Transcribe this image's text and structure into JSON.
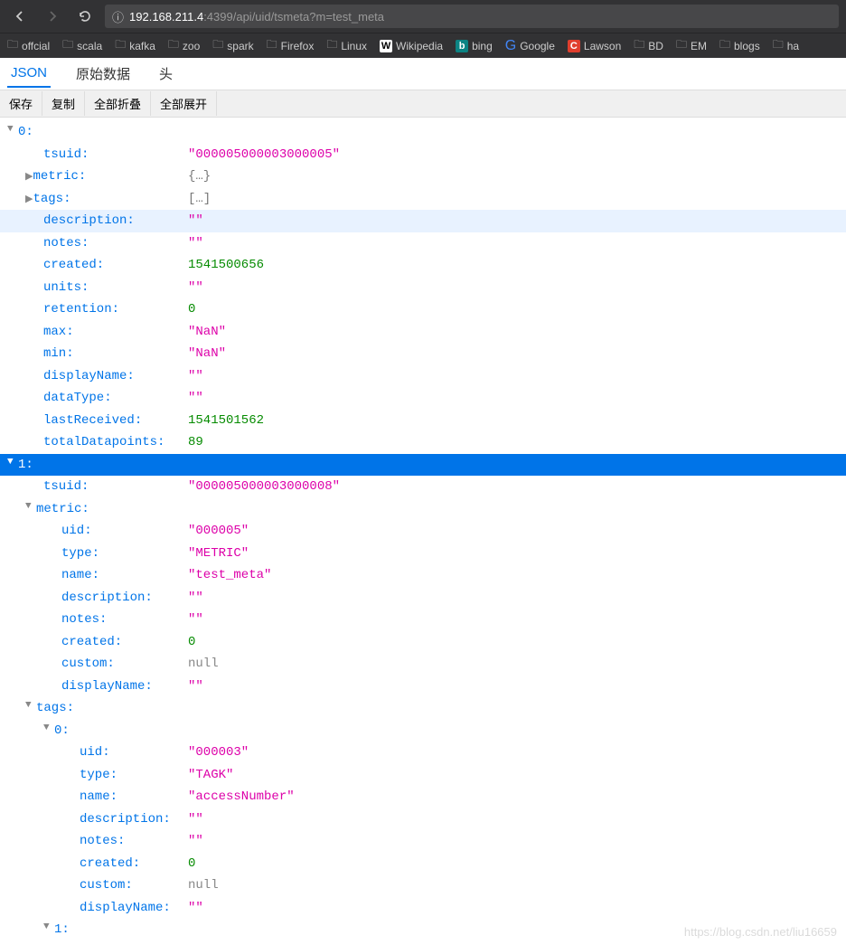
{
  "nav": {
    "url_host": "192.168.211.4",
    "url_port": ":4399",
    "url_path": "/api/uid/tsmeta?m=test_meta"
  },
  "bookmarks": [
    "offcial",
    "scala",
    "kafka",
    "zoo",
    "spark",
    "Firefox",
    "Linux",
    "Wikipedia",
    "bing",
    "Google",
    "Lawson",
    "BD",
    "EM",
    "blogs",
    "ha"
  ],
  "tabs": {
    "json": "JSON",
    "raw": "原始数据",
    "headers": "头"
  },
  "toolbar": {
    "save": "保存",
    "copy": "复制",
    "collapse": "全部折叠",
    "expand": "全部展开"
  },
  "json": {
    "idx0": "0:",
    "idx1": "1:",
    "item0": {
      "tsuid_k": "tsuid:",
      "tsuid_v": "\"000005000003000005\"",
      "metric_k": "metric:",
      "metric_v": "{…}",
      "tags_k": "tags:",
      "tags_v": "[…]",
      "description_k": "description:",
      "description_v": "\"\"",
      "notes_k": "notes:",
      "notes_v": "\"\"",
      "created_k": "created:",
      "created_v": "1541500656",
      "units_k": "units:",
      "units_v": "\"\"",
      "retention_k": "retention:",
      "retention_v": "0",
      "max_k": "max:",
      "max_v": "\"NaN\"",
      "min_k": "min:",
      "min_v": "\"NaN\"",
      "displayName_k": "displayName:",
      "displayName_v": "\"\"",
      "dataType_k": "dataType:",
      "dataType_v": "\"\"",
      "lastReceived_k": "lastReceived:",
      "lastReceived_v": "1541501562",
      "totalDatapoints_k": "totalDatapoints:",
      "totalDatapoints_v": "89"
    },
    "item1": {
      "tsuid_k": "tsuid:",
      "tsuid_v": "\"000005000003000008\"",
      "metric_k": "metric:",
      "metric": {
        "uid_k": "uid:",
        "uid_v": "\"000005\"",
        "type_k": "type:",
        "type_v": "\"METRIC\"",
        "name_k": "name:",
        "name_v": "\"test_meta\"",
        "description_k": "description:",
        "description_v": "\"\"",
        "notes_k": "notes:",
        "notes_v": "\"\"",
        "created_k": "created:",
        "created_v": "0",
        "custom_k": "custom:",
        "custom_v": "null",
        "displayName_k": "displayName:",
        "displayName_v": "\"\""
      },
      "tags_k": "tags:",
      "tags0_idx": "0:",
      "tags0": {
        "uid_k": "uid:",
        "uid_v": "\"000003\"",
        "type_k": "type:",
        "type_v": "\"TAGK\"",
        "name_k": "name:",
        "name_v": "\"accessNumber\"",
        "description_k": "description:",
        "description_v": "\"\"",
        "notes_k": "notes:",
        "notes_v": "\"\"",
        "created_k": "created:",
        "created_v": "0",
        "custom_k": "custom:",
        "custom_v": "null",
        "displayName_k": "displayName:",
        "displayName_v": "\"\""
      },
      "tags1_idx": "1:"
    }
  },
  "watermark": "https://blog.csdn.net/liu16659"
}
